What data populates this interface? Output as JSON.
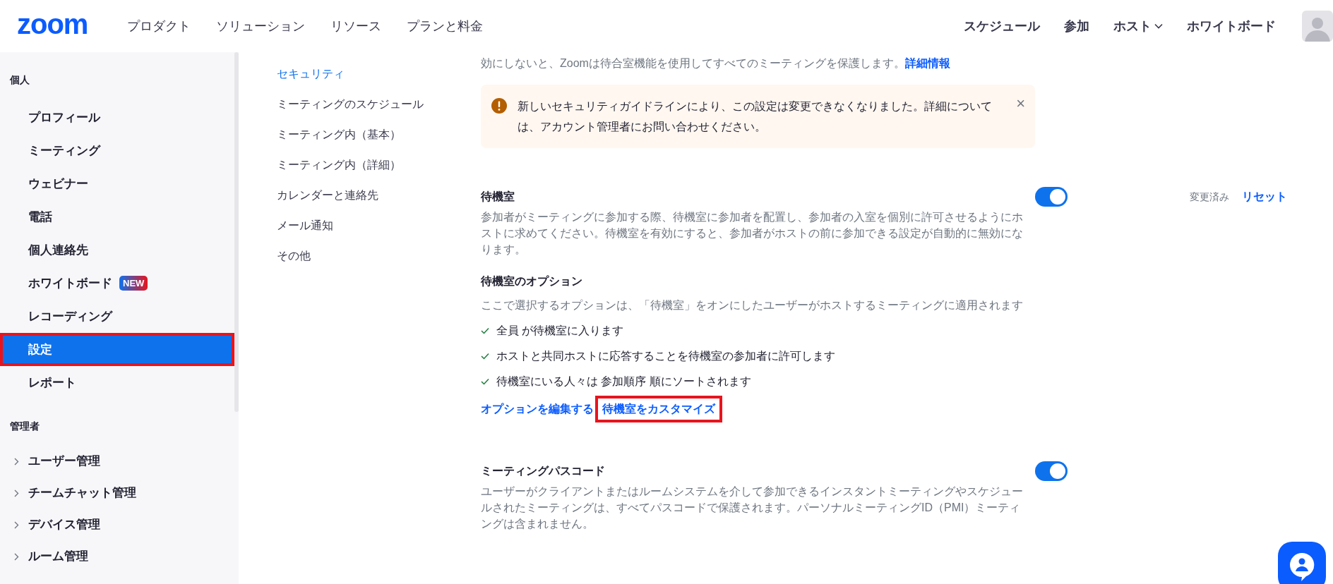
{
  "header": {
    "logo": "zoom",
    "nav_left": [
      "プロダクト",
      "ソリューション",
      "リソース",
      "プランと料金"
    ],
    "nav_right": [
      {
        "label": "スケジュール",
        "dropdown": false
      },
      {
        "label": "参加",
        "dropdown": false
      },
      {
        "label": "ホスト",
        "dropdown": true
      },
      {
        "label": "ホワイトボード",
        "dropdown": false
      }
    ]
  },
  "sidebar": {
    "sections": [
      {
        "title": "個人",
        "items": [
          {
            "label": "プロフィール",
            "selected": false,
            "highlighted": false,
            "expandable": false
          },
          {
            "label": "ミーティング",
            "selected": false,
            "highlighted": false,
            "expandable": false
          },
          {
            "label": "ウェビナー",
            "selected": false,
            "highlighted": false,
            "expandable": false
          },
          {
            "label": "電話",
            "selected": false,
            "highlighted": false,
            "expandable": false
          },
          {
            "label": "個人連絡先",
            "selected": false,
            "highlighted": false,
            "expandable": false
          },
          {
            "label": "ホワイトボード",
            "badge": "NEW",
            "selected": false,
            "highlighted": false,
            "expandable": false
          },
          {
            "label": "レコーディング",
            "selected": false,
            "highlighted": false,
            "expandable": false
          },
          {
            "label": "設定",
            "selected": true,
            "highlighted": true,
            "expandable": false
          },
          {
            "label": "レポート",
            "selected": false,
            "highlighted": false,
            "expandable": false
          }
        ]
      },
      {
        "title": "管理者",
        "items": [
          {
            "label": "ユーザー管理",
            "selected": false,
            "highlighted": false,
            "expandable": true
          },
          {
            "label": "チームチャット管理",
            "selected": false,
            "highlighted": false,
            "expandable": true
          },
          {
            "label": "デバイス管理",
            "selected": false,
            "highlighted": false,
            "expandable": true
          },
          {
            "label": "ルーム管理",
            "selected": false,
            "highlighted": false,
            "expandable": true
          }
        ]
      }
    ]
  },
  "subnav": [
    {
      "label": "セキュリティ",
      "selected": true
    },
    {
      "label": "ミーティングのスケジュール",
      "selected": false
    },
    {
      "label": "ミーティング内（基本）",
      "selected": false
    },
    {
      "label": "ミーティング内（詳細）",
      "selected": false
    },
    {
      "label": "カレンダーと連絡先",
      "selected": false
    },
    {
      "label": "メール通知",
      "selected": false
    },
    {
      "label": "その他",
      "selected": false
    }
  ],
  "intro": {
    "text": "効にしないと、Zoomは待合室機能を使用してすべてのミーティングを保護します。",
    "link": "詳細情報"
  },
  "alert": {
    "text": "新しいセキュリティガイドラインにより、この設定は変更できなくなりました。詳細については、アカウント管理者にお問い合わせください。",
    "close": "×"
  },
  "settings": [
    {
      "title": "待機室",
      "on": true,
      "status": "変更済み",
      "reset": "リセット",
      "description": "参加者がミーティングに参加する際、待機室に参加者を配置し、参加者の入室を個別に許可させるようにホストに求めてください。待機室を有効にすると、参加者がホストの前に参加できる設定が自動的に無効になります。",
      "options_title": "待機室のオプション",
      "options_subtitle": "ここで選択するオプションは、「待機室」をオンにしたユーザーがホストするミーティングに適用されます",
      "options": [
        "全員 が待機室に入ります",
        "ホストと共同ホストに応答することを待機室の参加者に許可します",
        "待機室にいる人々は 参加順序 順にソートされます"
      ],
      "links": [
        {
          "label": "オプションを編集する",
          "highlighted": false
        },
        {
          "label": "待機室をカスタマイズ",
          "highlighted": true
        }
      ]
    },
    {
      "title": "ミーティングパスコード",
      "on": true,
      "description": "ユーザーがクライアントまたはルームシステムを介して参加できるインスタントミーティングやスケジュールされたミーティングは、すべてパスコードで保護されます。パーソナルミーティングID（PMI）ミーティングは含まれません。"
    }
  ]
}
